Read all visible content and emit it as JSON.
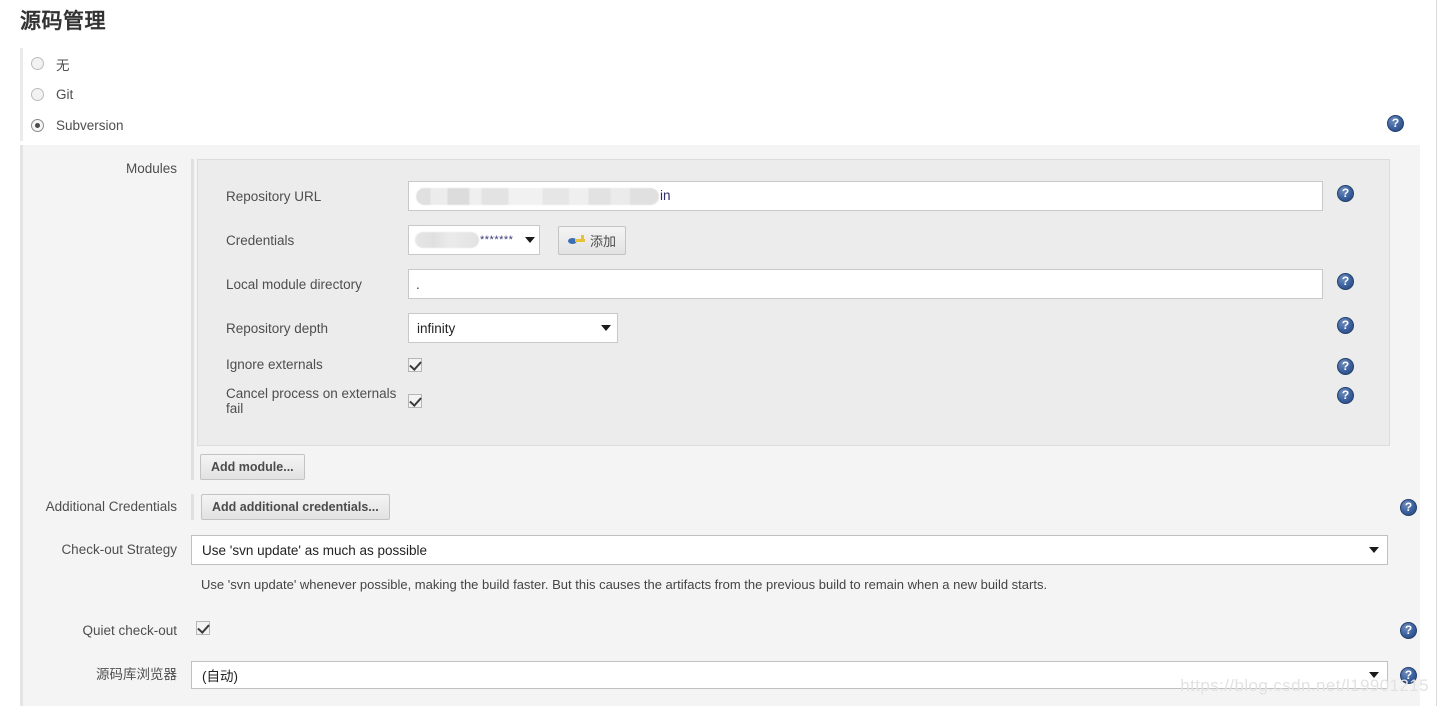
{
  "page": {
    "title": "源码管理",
    "watermark": "https://blog.csdn.net/l19901215"
  },
  "scm_options": [
    {
      "label": "无",
      "selected": false
    },
    {
      "label": "Git",
      "selected": false
    },
    {
      "label": "Subversion",
      "selected": true
    }
  ],
  "subversion": {
    "modules_label": "Modules",
    "fields": {
      "repository_url": {
        "label": "Repository URL",
        "value_redacted": true,
        "visible_suffix": "in"
      },
      "credentials": {
        "label": "Credentials",
        "value_redacted": true,
        "masked_value": "*******",
        "add_button": "添加",
        "add_button_icon": "key-icon"
      },
      "local_module_directory": {
        "label": "Local module directory",
        "value": "."
      },
      "repository_depth": {
        "label": "Repository depth",
        "value": "infinity"
      },
      "ignore_externals": {
        "label": "Ignore externals",
        "checked": true
      },
      "cancel_process_on_externals_fail": {
        "label": "Cancel process on externals fail",
        "checked": true
      }
    },
    "add_module_button": "Add module...",
    "additional_credentials": {
      "label": "Additional Credentials",
      "button": "Add additional credentials..."
    },
    "checkout_strategy": {
      "label": "Check-out Strategy",
      "value": "Use 'svn update' as much as possible",
      "description": "Use 'svn update' whenever possible, making the build faster. But this causes the artifacts from the previous build to remain when a new build starts."
    },
    "quiet_checkout": {
      "label": "Quiet check-out",
      "checked": true
    },
    "repository_browser": {
      "label": "源码库浏览器",
      "value": "(自动)"
    }
  },
  "icons": {
    "help": "help-icon"
  },
  "colors": {
    "help_blue": "#3a5f9c",
    "panel_bg": "#f4f4f4",
    "module_bg": "#ececec",
    "text": "#4e4e4e"
  }
}
